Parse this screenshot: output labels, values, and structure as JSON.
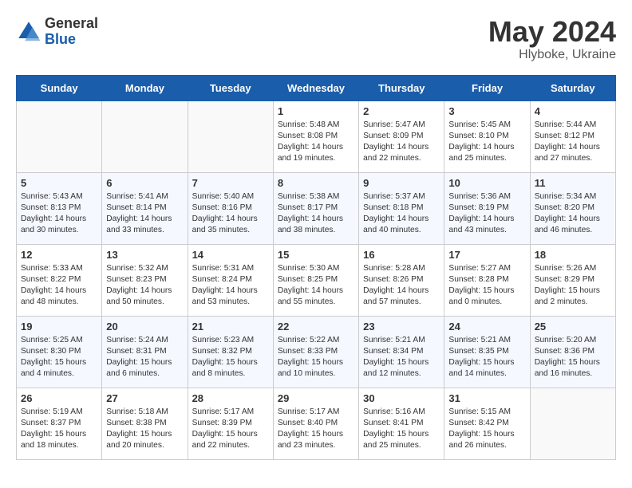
{
  "header": {
    "logo_general": "General",
    "logo_blue": "Blue",
    "month_year": "May 2024",
    "location": "Hlyboke, Ukraine"
  },
  "days_of_week": [
    "Sunday",
    "Monday",
    "Tuesday",
    "Wednesday",
    "Thursday",
    "Friday",
    "Saturday"
  ],
  "weeks": [
    [
      {
        "day": "",
        "info": ""
      },
      {
        "day": "",
        "info": ""
      },
      {
        "day": "",
        "info": ""
      },
      {
        "day": "1",
        "info": "Sunrise: 5:48 AM\nSunset: 8:08 PM\nDaylight: 14 hours\nand 19 minutes."
      },
      {
        "day": "2",
        "info": "Sunrise: 5:47 AM\nSunset: 8:09 PM\nDaylight: 14 hours\nand 22 minutes."
      },
      {
        "day": "3",
        "info": "Sunrise: 5:45 AM\nSunset: 8:10 PM\nDaylight: 14 hours\nand 25 minutes."
      },
      {
        "day": "4",
        "info": "Sunrise: 5:44 AM\nSunset: 8:12 PM\nDaylight: 14 hours\nand 27 minutes."
      }
    ],
    [
      {
        "day": "5",
        "info": "Sunrise: 5:43 AM\nSunset: 8:13 PM\nDaylight: 14 hours\nand 30 minutes."
      },
      {
        "day": "6",
        "info": "Sunrise: 5:41 AM\nSunset: 8:14 PM\nDaylight: 14 hours\nand 33 minutes."
      },
      {
        "day": "7",
        "info": "Sunrise: 5:40 AM\nSunset: 8:16 PM\nDaylight: 14 hours\nand 35 minutes."
      },
      {
        "day": "8",
        "info": "Sunrise: 5:38 AM\nSunset: 8:17 PM\nDaylight: 14 hours\nand 38 minutes."
      },
      {
        "day": "9",
        "info": "Sunrise: 5:37 AM\nSunset: 8:18 PM\nDaylight: 14 hours\nand 40 minutes."
      },
      {
        "day": "10",
        "info": "Sunrise: 5:36 AM\nSunset: 8:19 PM\nDaylight: 14 hours\nand 43 minutes."
      },
      {
        "day": "11",
        "info": "Sunrise: 5:34 AM\nSunset: 8:20 PM\nDaylight: 14 hours\nand 46 minutes."
      }
    ],
    [
      {
        "day": "12",
        "info": "Sunrise: 5:33 AM\nSunset: 8:22 PM\nDaylight: 14 hours\nand 48 minutes."
      },
      {
        "day": "13",
        "info": "Sunrise: 5:32 AM\nSunset: 8:23 PM\nDaylight: 14 hours\nand 50 minutes."
      },
      {
        "day": "14",
        "info": "Sunrise: 5:31 AM\nSunset: 8:24 PM\nDaylight: 14 hours\nand 53 minutes."
      },
      {
        "day": "15",
        "info": "Sunrise: 5:30 AM\nSunset: 8:25 PM\nDaylight: 14 hours\nand 55 minutes."
      },
      {
        "day": "16",
        "info": "Sunrise: 5:28 AM\nSunset: 8:26 PM\nDaylight: 14 hours\nand 57 minutes."
      },
      {
        "day": "17",
        "info": "Sunrise: 5:27 AM\nSunset: 8:28 PM\nDaylight: 15 hours\nand 0 minutes."
      },
      {
        "day": "18",
        "info": "Sunrise: 5:26 AM\nSunset: 8:29 PM\nDaylight: 15 hours\nand 2 minutes."
      }
    ],
    [
      {
        "day": "19",
        "info": "Sunrise: 5:25 AM\nSunset: 8:30 PM\nDaylight: 15 hours\nand 4 minutes."
      },
      {
        "day": "20",
        "info": "Sunrise: 5:24 AM\nSunset: 8:31 PM\nDaylight: 15 hours\nand 6 minutes."
      },
      {
        "day": "21",
        "info": "Sunrise: 5:23 AM\nSunset: 8:32 PM\nDaylight: 15 hours\nand 8 minutes."
      },
      {
        "day": "22",
        "info": "Sunrise: 5:22 AM\nSunset: 8:33 PM\nDaylight: 15 hours\nand 10 minutes."
      },
      {
        "day": "23",
        "info": "Sunrise: 5:21 AM\nSunset: 8:34 PM\nDaylight: 15 hours\nand 12 minutes."
      },
      {
        "day": "24",
        "info": "Sunrise: 5:21 AM\nSunset: 8:35 PM\nDaylight: 15 hours\nand 14 minutes."
      },
      {
        "day": "25",
        "info": "Sunrise: 5:20 AM\nSunset: 8:36 PM\nDaylight: 15 hours\nand 16 minutes."
      }
    ],
    [
      {
        "day": "26",
        "info": "Sunrise: 5:19 AM\nSunset: 8:37 PM\nDaylight: 15 hours\nand 18 minutes."
      },
      {
        "day": "27",
        "info": "Sunrise: 5:18 AM\nSunset: 8:38 PM\nDaylight: 15 hours\nand 20 minutes."
      },
      {
        "day": "28",
        "info": "Sunrise: 5:17 AM\nSunset: 8:39 PM\nDaylight: 15 hours\nand 22 minutes."
      },
      {
        "day": "29",
        "info": "Sunrise: 5:17 AM\nSunset: 8:40 PM\nDaylight: 15 hours\nand 23 minutes."
      },
      {
        "day": "30",
        "info": "Sunrise: 5:16 AM\nSunset: 8:41 PM\nDaylight: 15 hours\nand 25 minutes."
      },
      {
        "day": "31",
        "info": "Sunrise: 5:15 AM\nSunset: 8:42 PM\nDaylight: 15 hours\nand 26 minutes."
      },
      {
        "day": "",
        "info": ""
      }
    ]
  ]
}
